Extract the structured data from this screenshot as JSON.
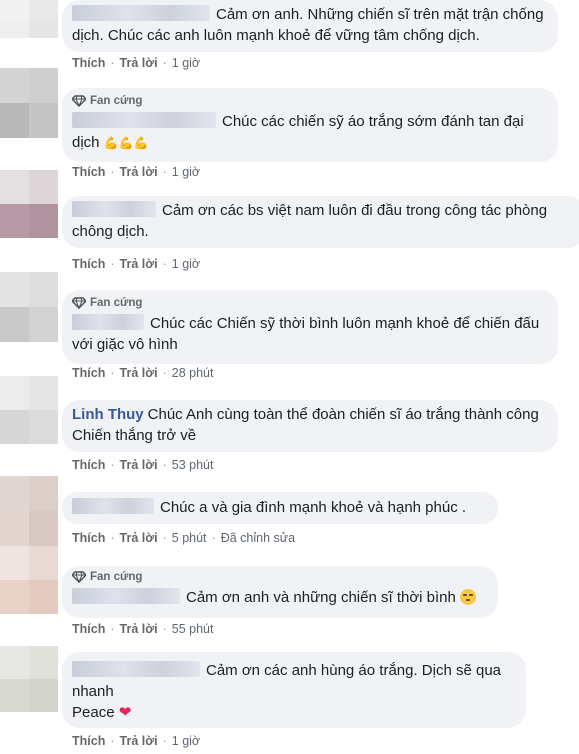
{
  "labels": {
    "like": "Thích",
    "reply": "Trả lời",
    "fan_badge": "Fan cứng"
  },
  "colors": {
    "bubble": "#f0f2f5",
    "meta": "#65676b",
    "badge_icon": "#4b4f56"
  },
  "comments": [
    {
      "author": "",
      "fan_badge": false,
      "text": "Cảm ơn anh. Những chiến sĩ trên mặt trận chống dịch. Chúc các anh luôn mạnh khoẻ để vững tâm chống dịch.",
      "time": "1 giờ",
      "edited": ""
    },
    {
      "author": "",
      "fan_badge": true,
      "text": "Chúc các chiến sỹ áo trắng sớm đánh tan đại dịch",
      "emoji": "flexed-biceps-icon x3",
      "time": "1 giờ",
      "edited": ""
    },
    {
      "author": "",
      "fan_badge": false,
      "text": "Cảm ơn các bs việt nam luôn đi đầu trong công tác phòng chông dịch.",
      "time": "1 giờ",
      "edited": ""
    },
    {
      "author": "",
      "fan_badge": true,
      "text": "Chúc các Chiến sỹ thời bình luôn mạnh khoẻ để chiến đấu với giặc vô hình",
      "time": "28 phút",
      "edited": ""
    },
    {
      "author": "Linh Thuy",
      "fan_badge": false,
      "text": "Chúc Anh cùng toàn thể đoàn chiến sĩ áo trắng thành công Chiến thắng trở về",
      "time": "53 phút",
      "edited": ""
    },
    {
      "author": "",
      "fan_badge": false,
      "text": "Chúc a và gia đình mạnh khoẻ và hạnh phúc .",
      "time": "5 phút",
      "edited": "Đã chỉnh sửa"
    },
    {
      "author": "",
      "fan_badge": true,
      "text": "Cảm ơn anh và những chiến sĩ thời bình",
      "emoji": "relieved-face-icon",
      "time": "55 phút",
      "edited": ""
    },
    {
      "author": "",
      "fan_badge": false,
      "text": "Cảm ơn các anh hùng áo trắng. Dịch sẽ qua nhanh",
      "text2": "Peace",
      "emoji": "red-heart-icon",
      "time": "1 giờ",
      "edited": ""
    }
  ]
}
